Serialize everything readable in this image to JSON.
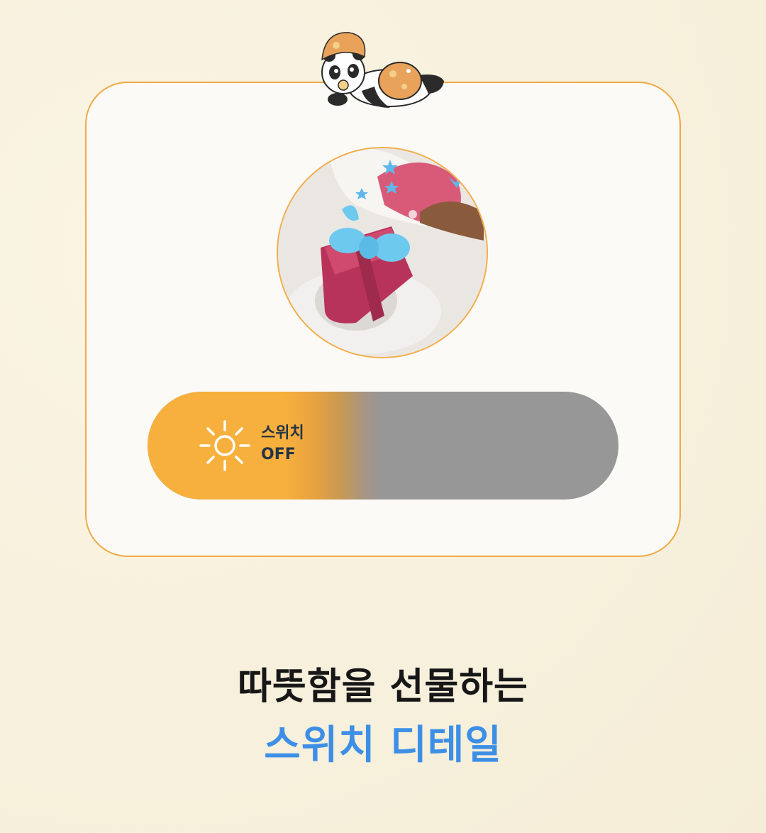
{
  "switch": {
    "line1": "스위치",
    "line2": "OFF",
    "fill_color": "#f7b03d",
    "track_color": "#979797"
  },
  "headline": {
    "line1": "따뜻함을 선물하는",
    "line2": "스위치 디테일",
    "line2_color": "#3d8fe6"
  },
  "icons": {
    "switch_icon": "sun-icon",
    "mascot": "panda-mascot"
  },
  "colors": {
    "background": "#f8f1de",
    "card_border": "#f0a946"
  }
}
